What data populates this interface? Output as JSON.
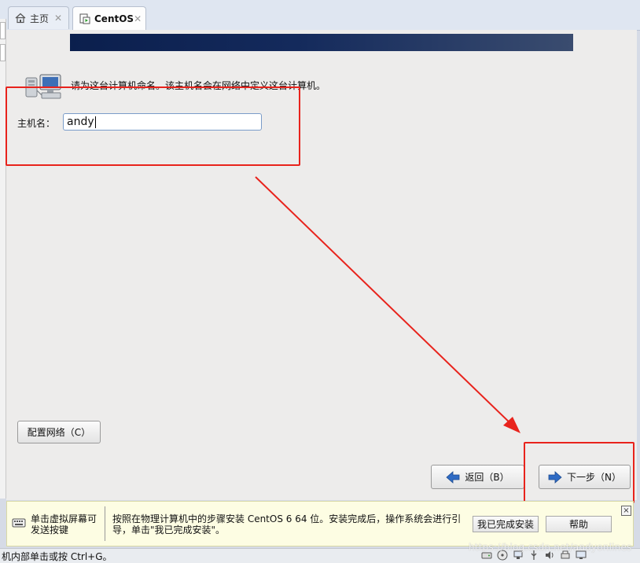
{
  "tabs": [
    {
      "label": "主页",
      "icon": "home-icon"
    },
    {
      "label": "CentOS",
      "icon": "vm-icon"
    }
  ],
  "installer": {
    "prompt": "请为这台计算机命名。该主机名会在网络中定义这台计算机。",
    "hostname_label": "主机名：",
    "hostname_value": "andy",
    "config_network_label": "配置网络（C）",
    "back_label": "返回（B）",
    "next_label": "下一步（N）"
  },
  "infobar": {
    "left_text": "单击虚拟屏幕可发送按键",
    "main_text": "按照在物理计算机中的步骤安装 CentOS 6 64 位。安装完成后，操作系统会进行引导，单击\"我已完成安装\"。",
    "done_label": "我已完成安装",
    "help_label": "帮助",
    "close_label": "×"
  },
  "statusbar": {
    "text": "机内部单击或按 Ctrl+G。"
  },
  "watermark": "https://blog.csdn.net/andyonlines",
  "colors": {
    "annotation": "#e8231c",
    "banner_dark": "#0b1f4d",
    "infobar_bg": "#fdfde3"
  }
}
